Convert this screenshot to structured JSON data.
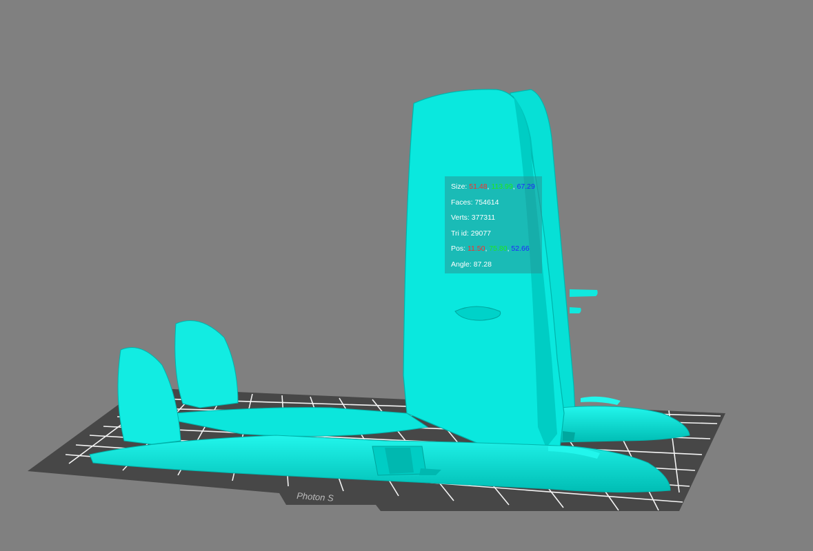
{
  "viewport": {
    "background_color": "#808080",
    "model_color": "#00F0E6",
    "build_plate_label": "Photon S"
  },
  "info": {
    "size_label": "Size:",
    "size_x": "51.48",
    "size_y": "113.99",
    "size_z": "67.29",
    "faces_label": "Faces:",
    "faces": "754614",
    "verts_label": "Verts:",
    "verts": "377311",
    "tri_label": "Tri id:",
    "tri_id": "29077",
    "pos_label": "Pos:",
    "pos_x": "11.50",
    "pos_y": "75.80",
    "pos_z": "52.66",
    "angle_label": "Angle:",
    "angle": "87.28",
    "sep": ","
  }
}
